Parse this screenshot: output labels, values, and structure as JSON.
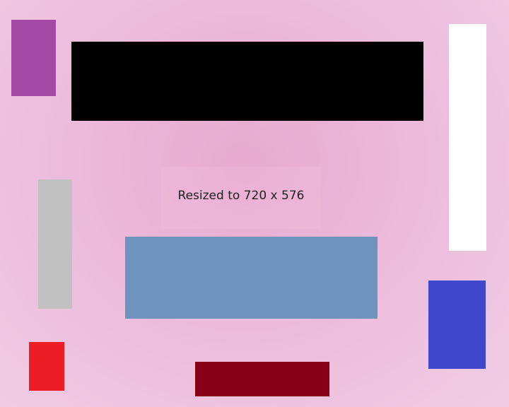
{
  "caption": "Resized to 720 x 576",
  "rectangles": [
    {
      "name": "purple-rectangle",
      "color": "#a24aa6"
    },
    {
      "name": "black-rectangle",
      "color": "#000000"
    },
    {
      "name": "white-rectangle",
      "color": "#ffffff"
    },
    {
      "name": "gray-rectangle",
      "color": "#c0c0c0"
    },
    {
      "name": "steel-blue-rectangle",
      "color": "#6f93bf"
    },
    {
      "name": "blue-rectangle",
      "color": "#3f47cc"
    },
    {
      "name": "red-rectangle",
      "color": "#ee1c24"
    },
    {
      "name": "maroon-rectangle",
      "color": "#880016"
    }
  ]
}
